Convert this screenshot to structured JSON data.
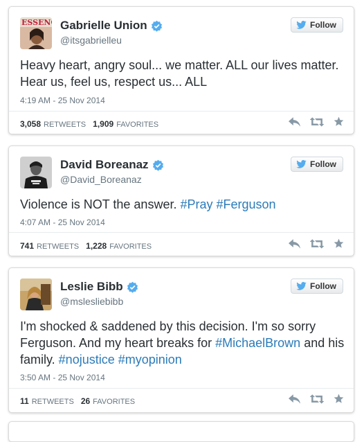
{
  "follow_label": "Follow",
  "retweets_label": "RETWEETS",
  "favorites_label": "FAVORITES",
  "colors": {
    "link": "#2b7bb9",
    "text": "#292f33",
    "muted": "#66757f",
    "verified": "#55acee"
  },
  "tweets": [
    {
      "name": "Gabrielle Union",
      "handle": "@itsgabrielleu",
      "text_plain": "Heavy heart, angry soul... we matter. ALL our lives matter. Hear us, feel us, respect us... ALL",
      "timestamp": "4:19 AM - 25 Nov 2014",
      "retweets": "3,058",
      "favorites": "1,909"
    },
    {
      "name": "David Boreanaz",
      "handle": "@David_Boreanaz",
      "text_plain": "Violence is NOT the answer. ",
      "hashtag_1": "#Pray",
      "hashtag_2": "#Ferguson",
      "timestamp": "4:07 AM - 25 Nov 2014",
      "retweets": "741",
      "favorites": "1,228"
    },
    {
      "name": "Leslie Bibb",
      "handle": "@mslesliebibb",
      "text_plain": "I'm shocked & saddened by this decision. I'm so sorry Ferguson. And my heart breaks for ",
      "hashtag_1": "#MichaelBrown",
      "text_mid": " and his family. ",
      "hashtag_2": "#nojustice",
      "hashtag_3": "#myopinion",
      "timestamp": "3:50 AM - 25 Nov 2014",
      "retweets": "11",
      "favorites": "26"
    }
  ]
}
